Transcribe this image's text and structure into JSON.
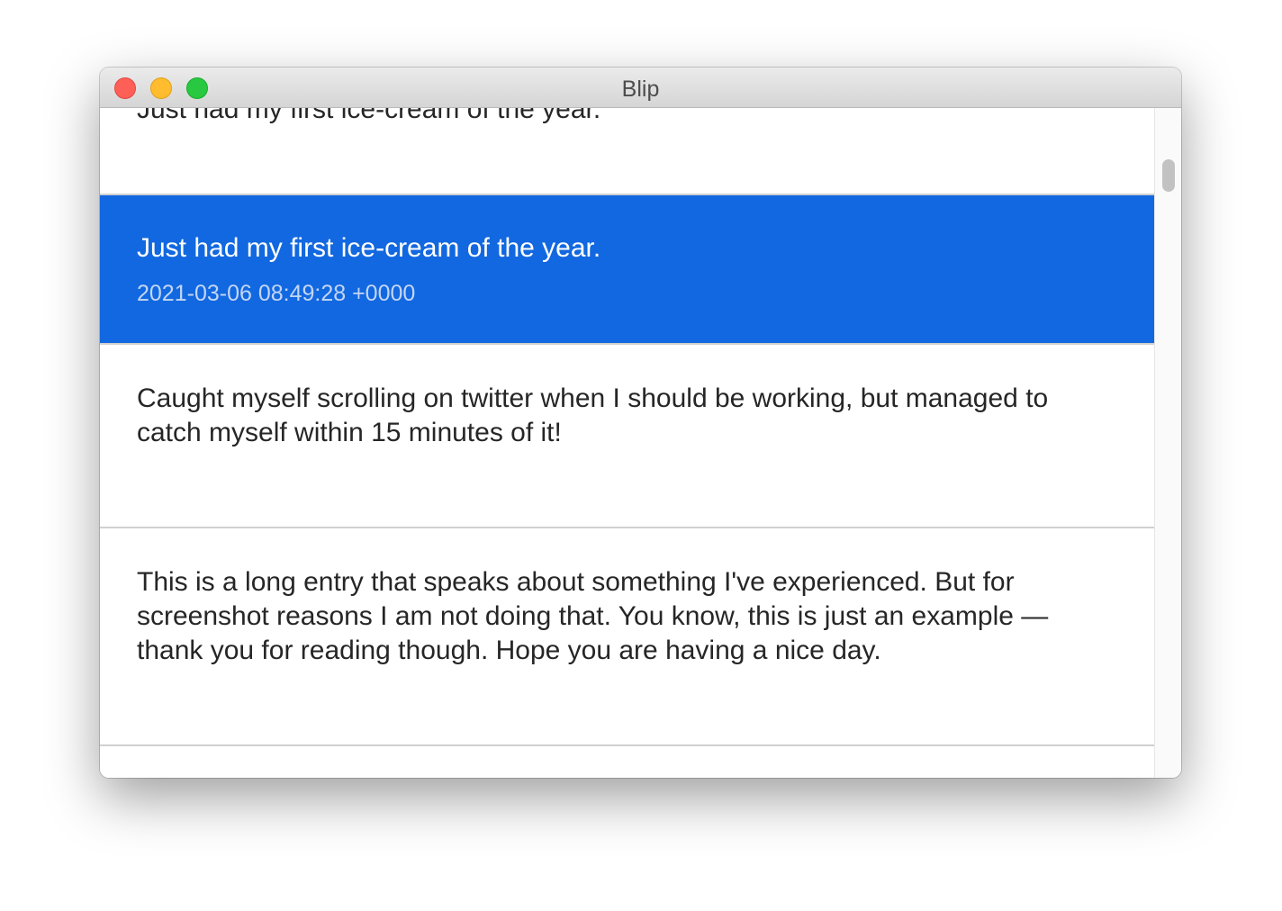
{
  "window": {
    "title": "Blip"
  },
  "entries": [
    {
      "text": "Just had my first ice-cream of the year.",
      "date": "",
      "selected": false
    },
    {
      "text": "Just had my first ice-cream of the year.",
      "date": "2021-03-06 08:49:28 +0000",
      "selected": true
    },
    {
      "text": "Caught myself scrolling on twitter when I should be working, but managed to catch myself within 15 minutes of it!",
      "date": "",
      "selected": false
    },
    {
      "text": "This is a long entry that speaks about something I've experienced. But for screenshot reasons I am not doing that. You know, this is just an example — thank you for reading though. Hope you are having a nice day.",
      "date": "",
      "selected": false
    }
  ],
  "colors": {
    "selection": "#1268e0",
    "close": "#fe5f57",
    "minimize": "#febc2e",
    "zoom": "#28c840"
  }
}
